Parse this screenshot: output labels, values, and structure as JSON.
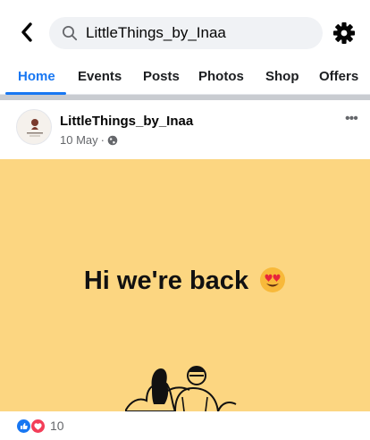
{
  "header": {
    "back_icon": "chevron-left-icon",
    "search_icon": "search-icon",
    "search_text": "LittleThings_by_Inaa",
    "settings_icon": "gear-icon"
  },
  "tabs": [
    {
      "label": "Home",
      "active": true
    },
    {
      "label": "Events",
      "active": false
    },
    {
      "label": "Posts",
      "active": false
    },
    {
      "label": "Photos",
      "active": false
    },
    {
      "label": "Shop",
      "active": false
    },
    {
      "label": "Offers",
      "active": false
    }
  ],
  "post": {
    "page_name": "LittleThings_by_Inaa",
    "date": "10 May",
    "separator": "·",
    "audience_icon": "globe-icon",
    "more_icon": "more-horizontal-icon",
    "more_label": "•••",
    "image": {
      "headline": "Hi we're back",
      "emoji": "heart-eyes-emoji",
      "background": "#fcd681"
    },
    "reactions": {
      "icons": [
        "like-reaction-icon",
        "love-reaction-icon"
      ],
      "count": "10"
    }
  },
  "colors": {
    "accent": "#1877f2",
    "text_secondary": "#65676b",
    "search_bg": "#f0f2f5"
  }
}
